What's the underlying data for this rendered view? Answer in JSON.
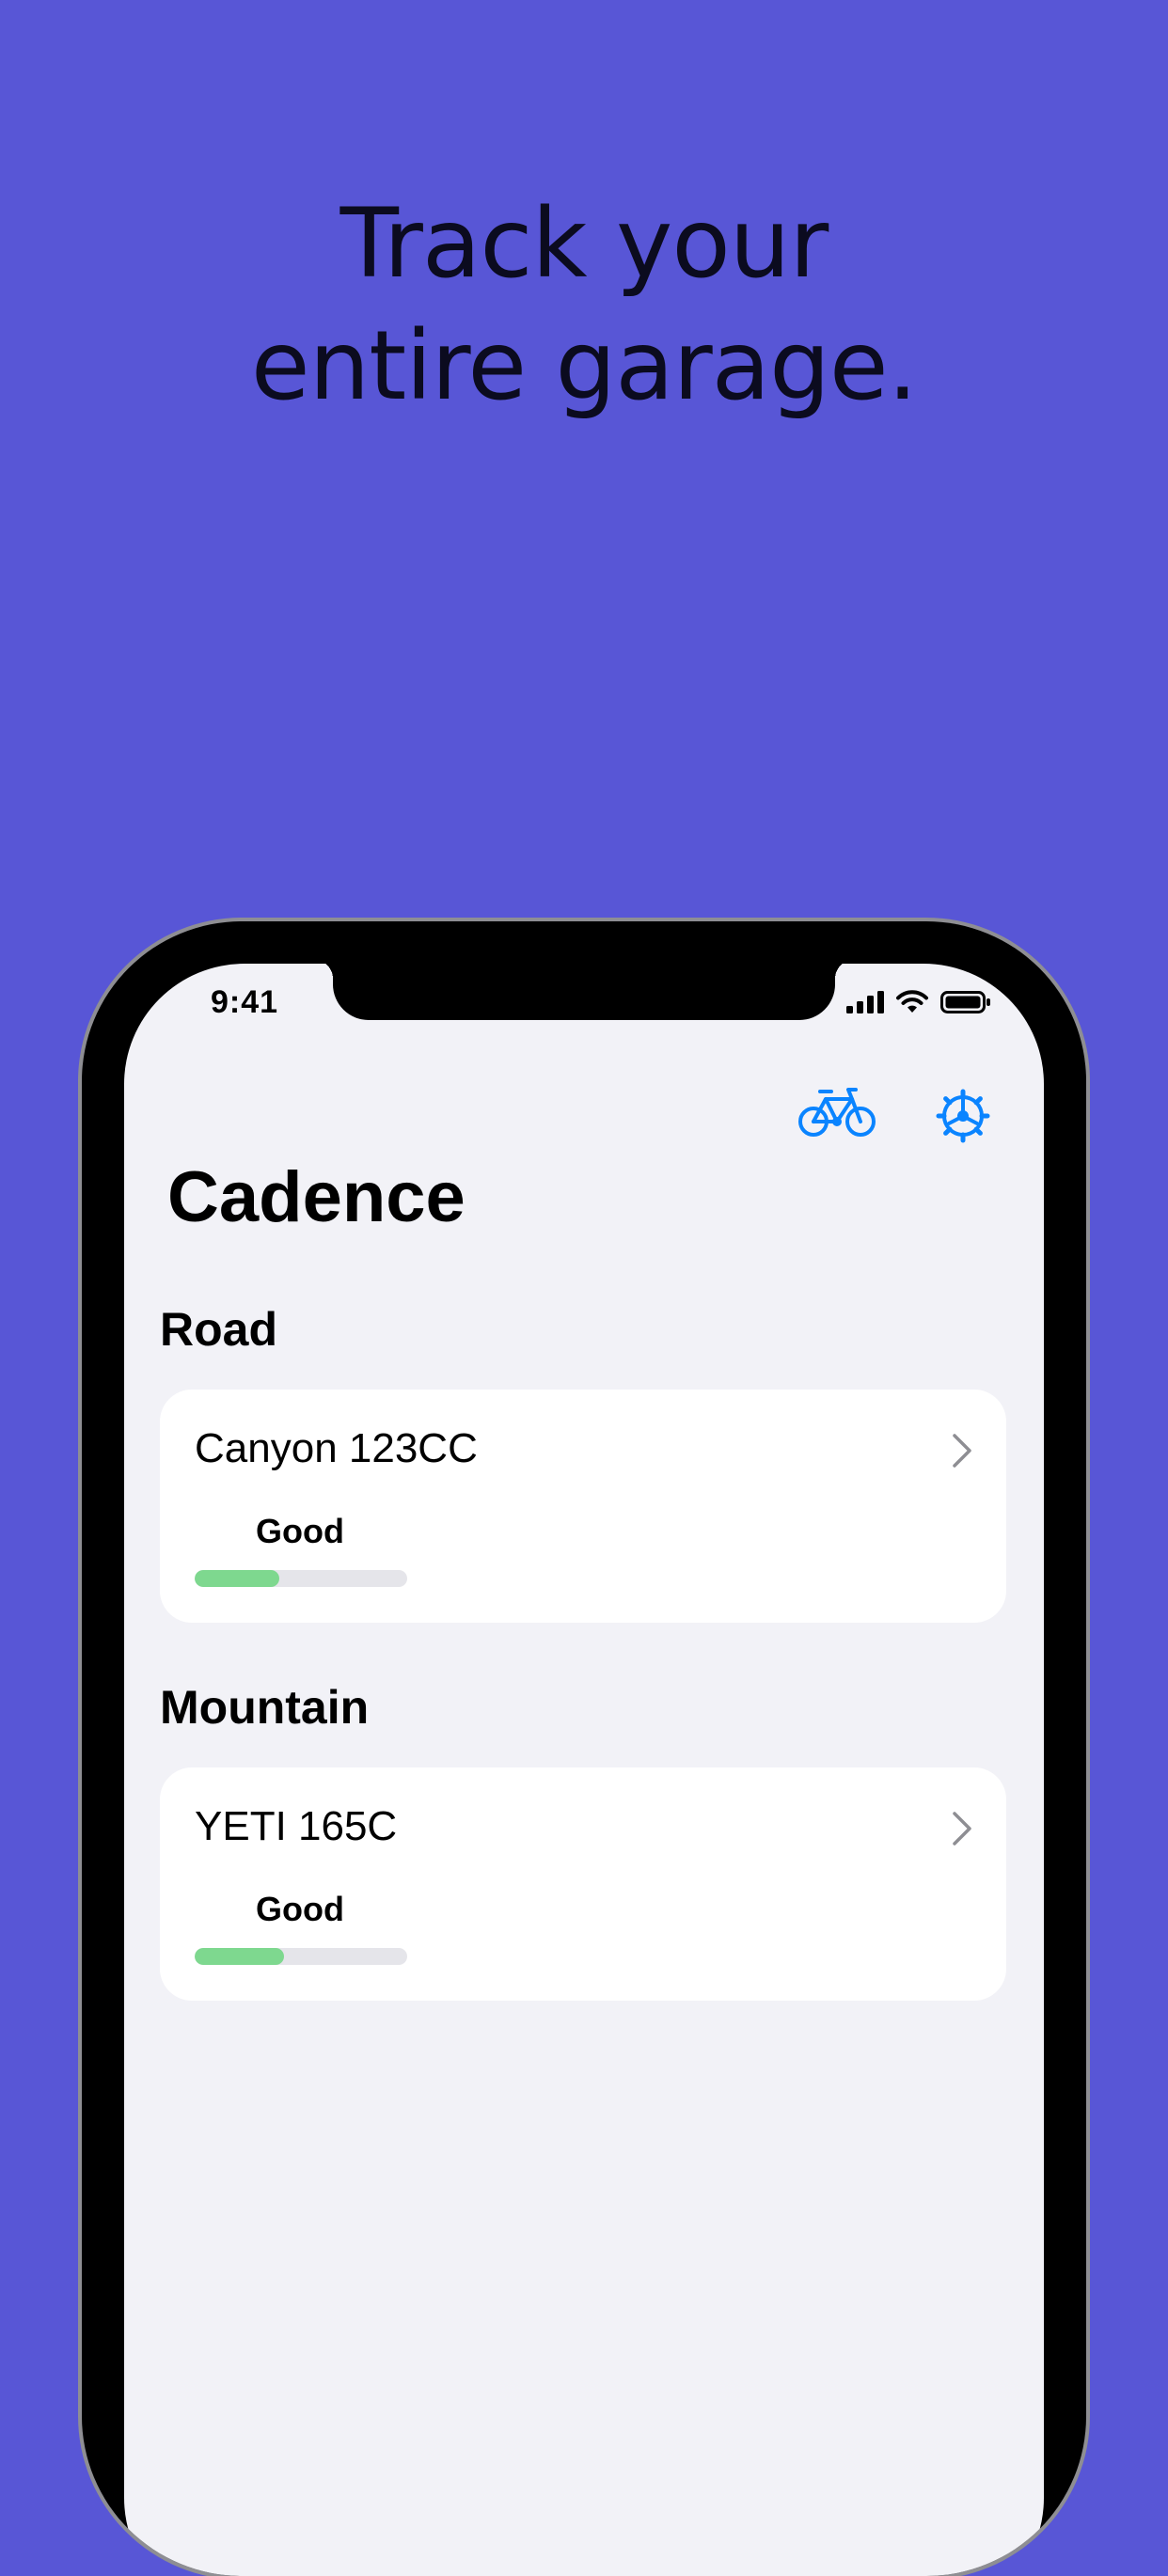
{
  "headline": {
    "line1": "Track your",
    "line2": "entire garage."
  },
  "status_bar": {
    "time": "9:41"
  },
  "toolbar": {
    "bike_icon": "bicycle-icon",
    "gear_icon": "settings-gear-icon"
  },
  "app": {
    "title": "Cadence"
  },
  "sections": [
    {
      "header": "Road",
      "bike": {
        "name": "Canyon 123CC",
        "status": "Good",
        "progress": 0.4
      }
    },
    {
      "header": "Mountain",
      "bike": {
        "name": "YETI 165C",
        "status": "Good",
        "progress": 0.42
      }
    }
  ],
  "colors": {
    "background": "#5856D6",
    "accent": "#0A84FF",
    "progress_good": "#7ED88F"
  }
}
